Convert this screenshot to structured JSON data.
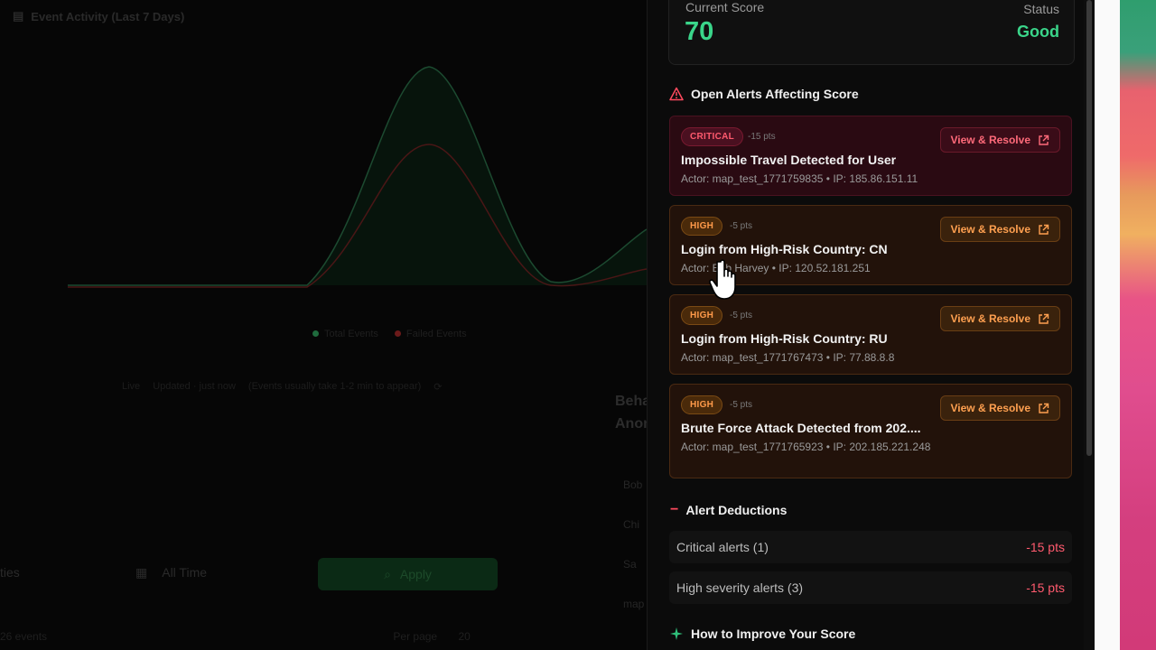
{
  "background": {
    "chart_title": "Event Activity (Last 7 Days)",
    "legend": [
      {
        "label": "Total Events",
        "color": "#1f6b3d"
      },
      {
        "label": "Failed Events",
        "color": "#6b1a1a"
      }
    ],
    "live_label": "Live",
    "updated_text": "Updated · just now",
    "hint_text": "(Events usually take 1-2 min to appear)",
    "behavior_title": "Behavior Anomalies",
    "filter_left": "ties",
    "all_time": "All Time",
    "apply": "Apply",
    "row_items": [
      "Bob",
      "Chi",
      "Sa",
      "map"
    ],
    "per_page_label": "Per page",
    "per_page_value": "20",
    "total_text": "26 events",
    "chart_colors": {
      "total": "#1c4a30",
      "failed": "#4a1616"
    }
  },
  "score": {
    "label": "Current Score",
    "value": "70",
    "status_label": "Status",
    "status_value": "Good",
    "accent": "#3ad58a"
  },
  "alerts_section": {
    "title": "Open Alerts Affecting Score",
    "icon": "warning-triangle-icon",
    "items": [
      {
        "severity": "CRITICAL",
        "points": "-15 pts",
        "title": "Impossible Travel Detected for User",
        "meta": "Actor: map_test_1771759835 • IP: 185.86.151.11",
        "button": "View & Resolve"
      },
      {
        "severity": "HIGH",
        "points": "-5 pts",
        "title": "Login from High-Risk Country: CN",
        "meta": "Actor: Bob Harvey • IP: 120.52.181.251",
        "button": "View & Resolve"
      },
      {
        "severity": "HIGH",
        "points": "-5 pts",
        "title": "Login from High-Risk Country: RU",
        "meta": "Actor: map_test_1771767473 • IP: 77.88.8.8",
        "button": "View & Resolve"
      },
      {
        "severity": "HIGH",
        "points": "-5 pts",
        "title": "Brute Force Attack Detected from 202....",
        "meta": "Actor: map_test_1771765923 • IP: 202.185.221.248",
        "button": "View & Resolve"
      }
    ]
  },
  "deductions": {
    "title": "Alert Deductions",
    "rows": [
      {
        "label": "Critical alerts (1)",
        "value": "-15 pts"
      },
      {
        "label": "High severity alerts (3)",
        "value": "-15 pts"
      }
    ]
  },
  "improve": {
    "title": "How to Improve Your Score",
    "icon": "sparkle-icon"
  }
}
